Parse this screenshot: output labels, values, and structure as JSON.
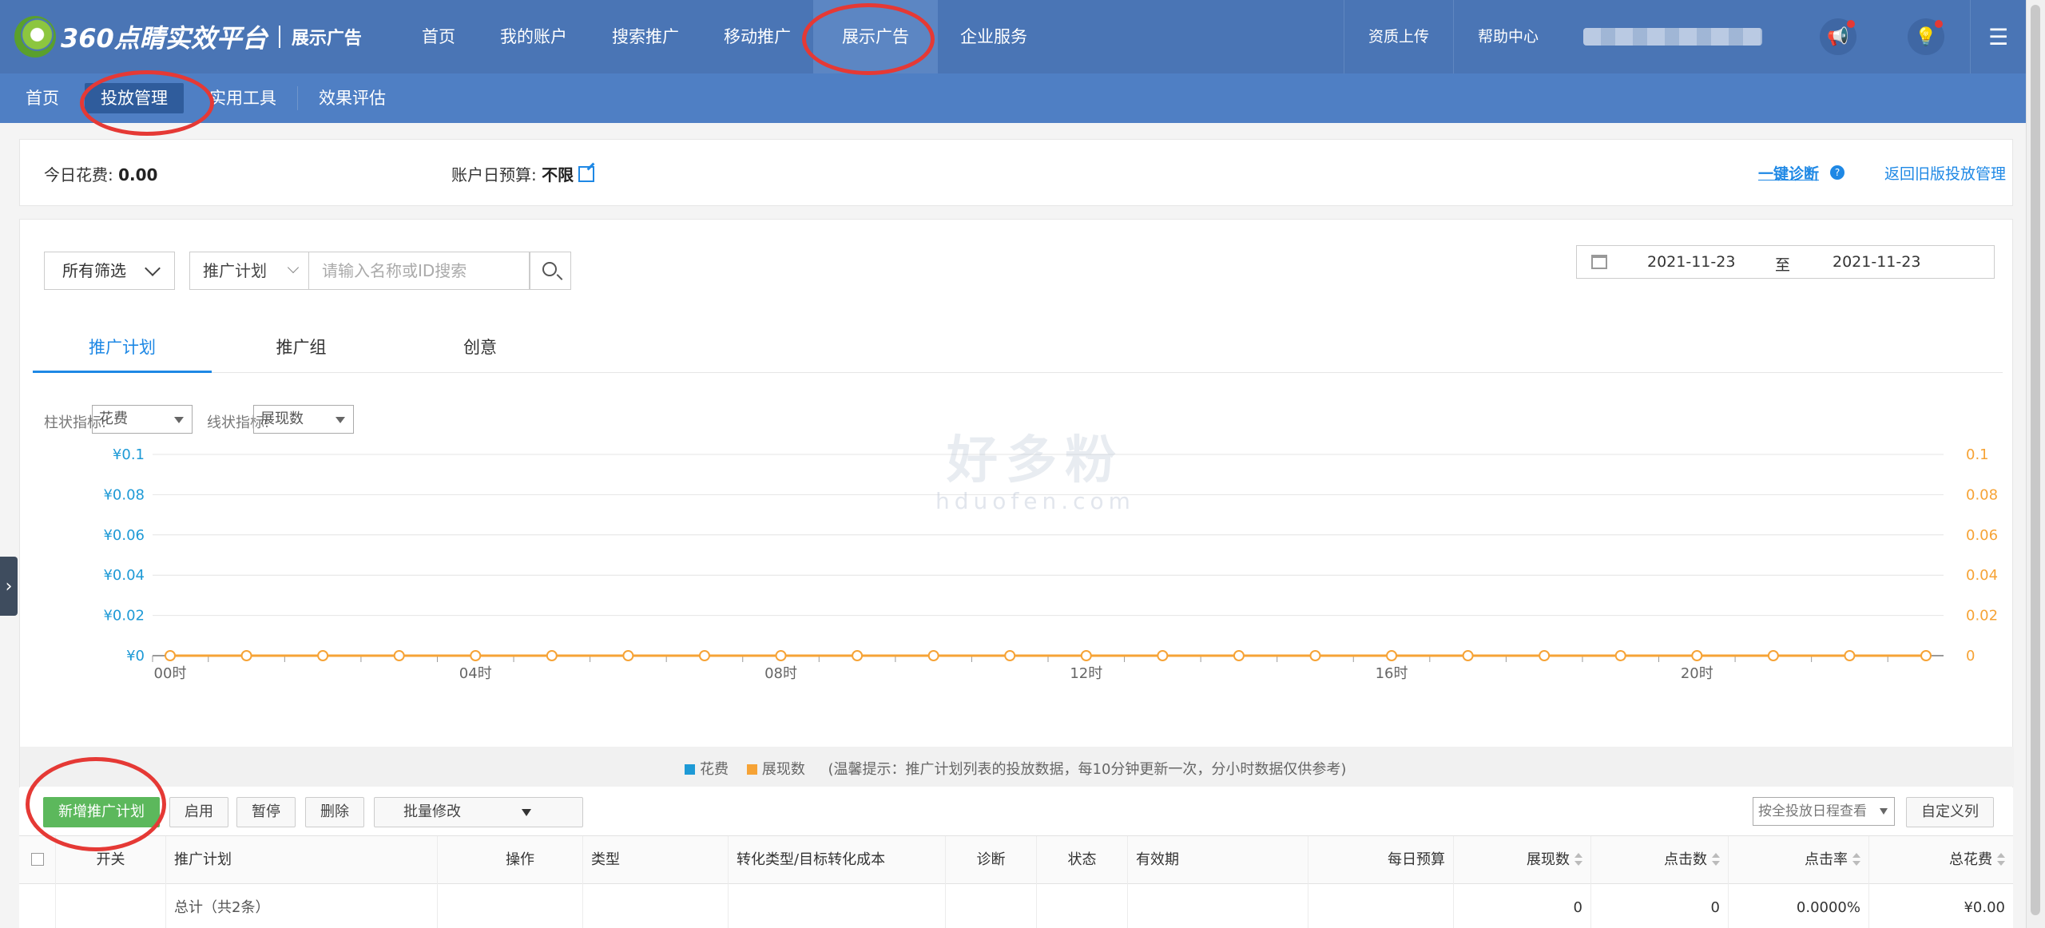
{
  "brand": {
    "name": "360点睛实效平台",
    "product": "展示广告"
  },
  "topnav": [
    {
      "label": "首页"
    },
    {
      "label": "我的账户"
    },
    {
      "label": "搜索推广"
    },
    {
      "label": "移动推广"
    },
    {
      "label": "展示广告",
      "active": true
    },
    {
      "label": "企业服务"
    }
  ],
  "top_links": {
    "upload": "资质上传",
    "help": "帮助中心"
  },
  "subnav": [
    {
      "label": "首页"
    },
    {
      "label": "投放管理",
      "active": true
    },
    {
      "label": "实用工具"
    },
    {
      "label": "效果评估"
    }
  ],
  "summary": {
    "spend_label": "今日花费:",
    "spend_value": "0.00",
    "budget_label": "账户日预算:",
    "budget_value": "不限",
    "diagnose": "一键诊断",
    "help_q": "?",
    "old_version": "返回旧版投放管理"
  },
  "filters": {
    "all_filter": "所有筛选",
    "type_select": "推广计划",
    "search_placeholder": "请输入名称或ID搜索",
    "date_start": "2021-11-23",
    "date_to": "至",
    "date_end": "2021-11-23"
  },
  "tabs": [
    {
      "label": "推广计划",
      "active": true
    },
    {
      "label": "推广组"
    },
    {
      "label": "创意"
    }
  ],
  "metrics": {
    "bar_label": "柱状指标:",
    "bar_value": "花费",
    "line_label": "线状指标:",
    "line_value": "展现数"
  },
  "chart_data": {
    "type": "line",
    "x": [
      "00时",
      "01时",
      "02时",
      "03时",
      "04时",
      "05时",
      "06时",
      "07时",
      "08时",
      "09时",
      "10时",
      "11时",
      "12时",
      "13时",
      "14时",
      "15时",
      "16时",
      "17时",
      "18时",
      "19时",
      "20时",
      "21时",
      "22时",
      "23时"
    ],
    "x_tick_labels": [
      "00时",
      "04时",
      "08时",
      "12时",
      "16时",
      "20时"
    ],
    "y_left_ticks": [
      "¥0",
      "¥0.02",
      "¥0.04",
      "¥0.06",
      "¥0.08",
      "¥0.1"
    ],
    "y_right_ticks": [
      "0",
      "0.02",
      "0.04",
      "0.06",
      "0.08",
      "0.1"
    ],
    "ylim": [
      0,
      0.1
    ],
    "series": [
      {
        "name": "花费",
        "axis": "left",
        "color": "#1e9ad6",
        "values": [
          0,
          0,
          0,
          0,
          0,
          0,
          0,
          0,
          0,
          0,
          0,
          0,
          0,
          0,
          0,
          0,
          0,
          0,
          0,
          0,
          0,
          0,
          0,
          0
        ]
      },
      {
        "name": "展现数",
        "axis": "right",
        "color": "#f6a336",
        "values": [
          0,
          0,
          0,
          0,
          0,
          0,
          0,
          0,
          0,
          0,
          0,
          0,
          0,
          0,
          0,
          0,
          0,
          0,
          0,
          0,
          0,
          0,
          0,
          0
        ]
      }
    ],
    "grid": true,
    "legend": "bottom-center",
    "note": "(温馨提示：推广计划列表的投放数据，每10分钟更新一次，分小时数据仅供参考)"
  },
  "watermark": {
    "cn": "好多粉",
    "en": "hduofen.com"
  },
  "actions": {
    "new_plan": "新增推广计划",
    "enable": "启用",
    "pause": "暂停",
    "delete": "删除",
    "batch_edit": "批量修改",
    "schedule": "按全投放日程查看",
    "custom_cols": "自定义列"
  },
  "table": {
    "columns": [
      "开关",
      "推广计划",
      "操作",
      "类型",
      "转化类型/目标转化成本",
      "诊断",
      "状态",
      "有效期",
      "每日预算",
      "展现数",
      "点击数",
      "点击率",
      "总花费"
    ],
    "total_label": "总计（共2条）",
    "total": {
      "impressions": "0",
      "clicks": "0",
      "ctr": "0.0000%",
      "spend": "¥0.00"
    }
  },
  "colors": {
    "topbar": "#4a75b5",
    "subbar": "#4f7fc4",
    "accent": "#1e88e5",
    "green": "#5cb85c",
    "annotation": "#e53935"
  }
}
